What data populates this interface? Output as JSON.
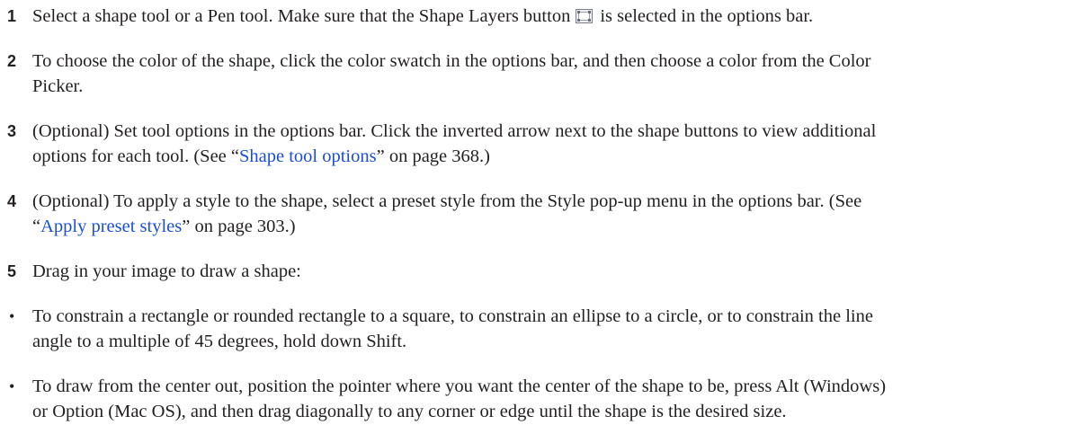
{
  "steps": [
    {
      "number": "1",
      "text_before_icon": "Select a shape tool or a Pen tool. Make sure that the Shape Layers button",
      "icon": "shape-layers-button-icon",
      "text_after_icon": "is selected in the options bar."
    },
    {
      "number": "2",
      "line1": "To choose the color of the shape, click the color swatch in the options bar, and then choose a color from the Color",
      "line2": "Picker."
    },
    {
      "number": "3",
      "line1": "(Optional) Set tool options in the options bar. Click the inverted arrow next to the shape buttons to view additional",
      "line2_before_link": "options for each tool. (See “",
      "link": "Shape tool options",
      "line2_after_link": "” on page 368.)"
    },
    {
      "number": "4",
      "line1": "(Optional) To apply a style to the shape, select a preset style from the Style pop-up menu in the options bar. (See",
      "line2_before_link": "“",
      "link": "Apply preset styles",
      "line2_after_link": "” on page 303.)"
    },
    {
      "number": "5",
      "text": "Drag in your image to draw a shape:"
    }
  ],
  "bullets": [
    {
      "symbol": "•",
      "line1": "To constrain a rectangle or rounded rectangle to a square, to constrain an ellipse to a circle, or to constrain the line",
      "line2": "angle to a multiple of 45 degrees, hold down Shift."
    },
    {
      "symbol": "•",
      "line1": "To draw from the center out, position the pointer where you want the center of the shape to be, press Alt (Windows)",
      "line2": "or Option (Mac OS), and then drag diagonally to any corner or edge until the shape is the desired size."
    }
  ]
}
